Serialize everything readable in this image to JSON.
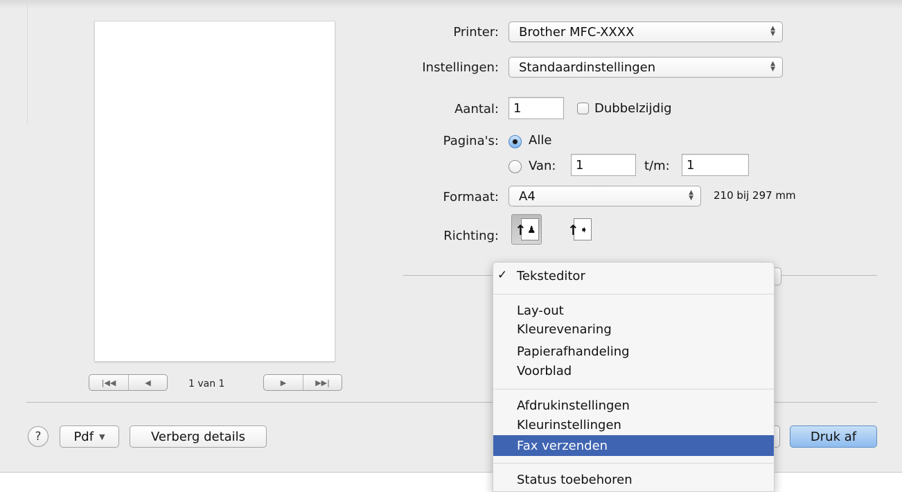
{
  "printer": {
    "label": "Printer:",
    "value": "Brother MFC-XXXX"
  },
  "presets": {
    "label": "Instellingen:",
    "value": "Standaardinstellingen"
  },
  "copies": {
    "label": "Aantal:",
    "value": "1",
    "two_sided_label": "Dubbelzijdig"
  },
  "pages": {
    "label": "Pagina's:",
    "all_label": "Alle",
    "from_label": "Van:",
    "from_value": "1",
    "to_label": "t/m:",
    "to_value": "1"
  },
  "paper": {
    "label": "Formaat:",
    "value": "A4",
    "dimensions": "210 bij 297 mm"
  },
  "orientation": {
    "label": "Richting:"
  },
  "preview": {
    "page_info": "1 van 1"
  },
  "menu": {
    "items": [
      {
        "label": "Teksteditor",
        "checked": true
      },
      {
        "label": "Lay-out"
      },
      {
        "label": "Kleurevenaring"
      },
      {
        "label": "Papierafhandeling"
      },
      {
        "label": "Voorblad"
      },
      {
        "label": "Afdrukinstellingen"
      },
      {
        "label": "Kleurinstellingen"
      },
      {
        "label": "Fax verzenden",
        "highlighted": true
      },
      {
        "label": "Status toebehoren"
      }
    ]
  },
  "footer": {
    "help": "?",
    "pdf_label": "Pdf",
    "hide_details_label": "Verberg details",
    "print_label": "Druk af"
  },
  "colors": {
    "highlight": "#3f64b2",
    "default_button": "#8dbcee"
  },
  "icons": [
    "first-page-icon",
    "previous-page-icon",
    "next-page-icon",
    "last-page-icon",
    "portrait-icon",
    "landscape-icon",
    "checkmark-icon",
    "dropdown-arrows-icon"
  ]
}
